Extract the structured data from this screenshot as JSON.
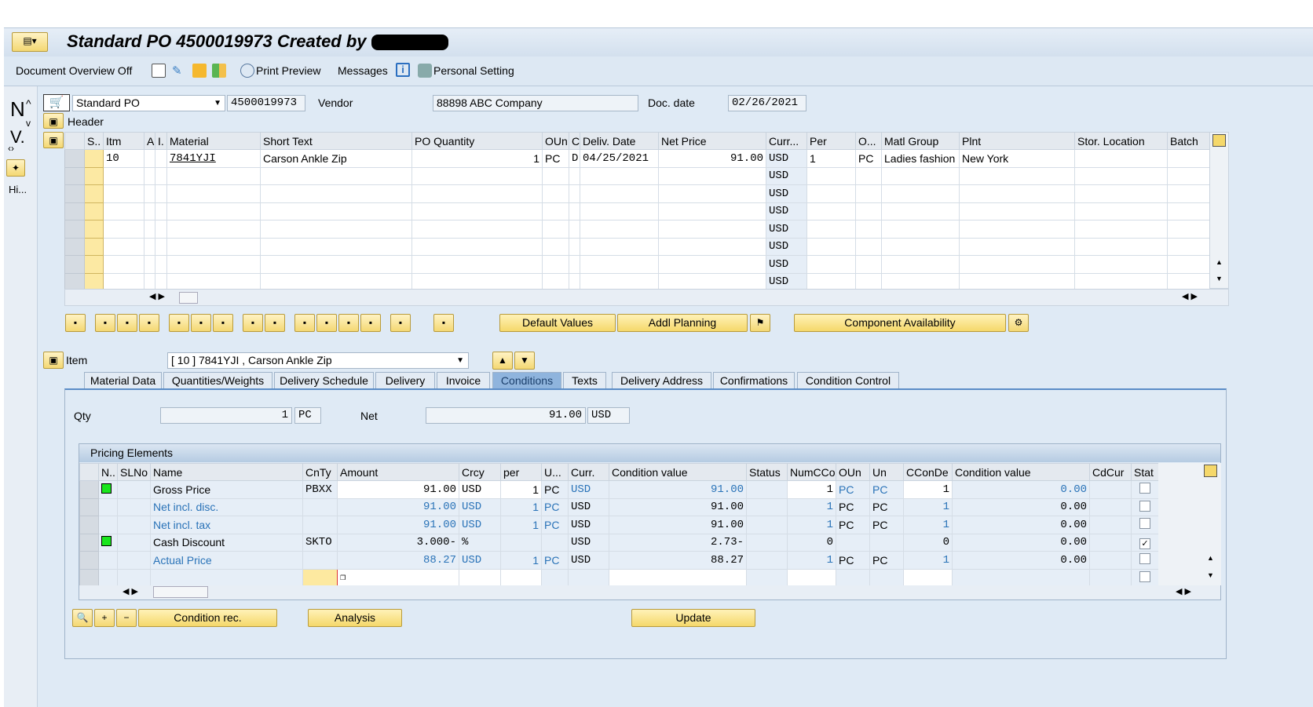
{
  "title": "Standard PO 4500019973 Created by",
  "toolbar": {
    "doc_overview": "Document Overview Off",
    "print_preview": "Print Preview",
    "messages": "Messages",
    "personal_setting": "Personal Setting"
  },
  "left_pane": {
    "nav_n": "N",
    "nav_v": "V.",
    "history": "Hi..."
  },
  "header": {
    "doc_type": "Standard PO",
    "po_number": "4500019973",
    "vendor_label": "Vendor",
    "vendor": "88898 ABC Company",
    "doc_date_label": "Doc. date",
    "doc_date": "02/26/2021",
    "section_label": "Header"
  },
  "items_grid": {
    "columns": [
      "S..",
      "Itm",
      "A",
      "I.",
      "Material",
      "Short Text",
      "PO Quantity",
      "OUn",
      "C",
      "Deliv. Date",
      "Net Price",
      "Curr...",
      "Per",
      "O...",
      "Matl Group",
      "Plnt",
      "Stor. Location",
      "Batch"
    ],
    "rows": [
      [
        "",
        "10",
        "",
        "",
        "7841YJI",
        "Carson Ankle Zip",
        "1",
        "PC",
        "D",
        "04/25/2021",
        "91.00",
        "USD",
        "1",
        "PC",
        "Ladies fashion",
        "New York",
        "",
        ""
      ],
      [
        "",
        "",
        "",
        "",
        "",
        "",
        "",
        "",
        "",
        "",
        "",
        "USD",
        "",
        "",
        "",
        "",
        "",
        ""
      ],
      [
        "",
        "",
        "",
        "",
        "",
        "",
        "",
        "",
        "",
        "",
        "",
        "USD",
        "",
        "",
        "",
        "",
        "",
        ""
      ],
      [
        "",
        "",
        "",
        "",
        "",
        "",
        "",
        "",
        "",
        "",
        "",
        "USD",
        "",
        "",
        "",
        "",
        "",
        ""
      ],
      [
        "",
        "",
        "",
        "",
        "",
        "",
        "",
        "",
        "",
        "",
        "",
        "USD",
        "",
        "",
        "",
        "",
        "",
        ""
      ],
      [
        "",
        "",
        "",
        "",
        "",
        "",
        "",
        "",
        "",
        "",
        "",
        "USD",
        "",
        "",
        "",
        "",
        "",
        ""
      ],
      [
        "",
        "",
        "",
        "",
        "",
        "",
        "",
        "",
        "",
        "",
        "",
        "USD",
        "",
        "",
        "",
        "",
        "",
        ""
      ],
      [
        "",
        "",
        "",
        "",
        "",
        "",
        "",
        "",
        "",
        "",
        "",
        "USD",
        "",
        "",
        "",
        "",
        "",
        ""
      ]
    ]
  },
  "item_buttons": {
    "default_values": "Default Values",
    "addl_planning": "Addl Planning",
    "component_availability": "Component Availability"
  },
  "item_detail": {
    "label": "Item",
    "selected": "[ 10 ] 7841YJI , Carson Ankle Zip"
  },
  "tabs": [
    "Material Data",
    "Quantities/Weights",
    "Delivery Schedule",
    "Delivery",
    "Invoice",
    "Conditions",
    "Texts",
    "Delivery Address",
    "Confirmations",
    "Condition Control"
  ],
  "active_tab": "Conditions",
  "conditions": {
    "qty_label": "Qty",
    "qty": "1",
    "qty_unit": "PC",
    "net_label": "Net",
    "net": "91.00",
    "net_curr": "USD"
  },
  "pricing": {
    "title": "Pricing Elements",
    "columns": [
      "N..",
      "SLNo",
      "Name",
      "CnTy",
      "Amount",
      "Crcy",
      "per",
      "U...",
      "Curr.",
      "Condition value",
      "Status",
      "NumCCo",
      "OUn",
      "Un",
      "CConDe",
      "Condition value",
      "CdCur",
      "Stat"
    ],
    "rows": [
      {
        "active": true,
        "stat": false,
        "cells": [
          "",
          "",
          "Gross Price",
          "PBXX",
          "91.00",
          "USD",
          "1",
          "PC",
          "USD",
          "91.00",
          "",
          "1",
          "PC",
          "PC",
          "1",
          "0.00",
          "",
          ""
        ],
        "blue": [
          8,
          9,
          12,
          13,
          15
        ]
      },
      {
        "active": false,
        "stat": false,
        "cells": [
          "",
          "",
          "Net incl. disc.",
          "",
          "91.00",
          "USD",
          "1",
          "PC",
          "USD",
          "91.00",
          "",
          "1",
          "PC",
          "PC",
          "1",
          "0.00",
          "",
          ""
        ],
        "blue": [
          2,
          4,
          5,
          6,
          7,
          11,
          14
        ]
      },
      {
        "active": false,
        "stat": false,
        "cells": [
          "",
          "",
          "Net incl. tax",
          "",
          "91.00",
          "USD",
          "1",
          "PC",
          "USD",
          "91.00",
          "",
          "1",
          "PC",
          "PC",
          "1",
          "0.00",
          "",
          ""
        ],
        "blue": [
          2,
          4,
          5,
          6,
          7,
          11,
          14
        ]
      },
      {
        "active": true,
        "stat": true,
        "cells": [
          "",
          "",
          "Cash Discount",
          "SKTO",
          "3.000-",
          "%",
          "",
          "",
          "USD",
          "2.73-",
          "",
          "0",
          "",
          "",
          "0",
          "0.00",
          "",
          ""
        ],
        "blue": []
      },
      {
        "active": false,
        "stat": false,
        "cells": [
          "",
          "",
          "Actual Price",
          "",
          "88.27",
          "USD",
          "1",
          "PC",
          "USD",
          "88.27",
          "",
          "1",
          "PC",
          "PC",
          "1",
          "0.00",
          "",
          ""
        ],
        "blue": [
          2,
          4,
          5,
          6,
          7,
          11,
          14
        ]
      }
    ]
  },
  "bottom_buttons": {
    "condition_rec": "Condition rec.",
    "analysis": "Analysis",
    "update": "Update"
  }
}
